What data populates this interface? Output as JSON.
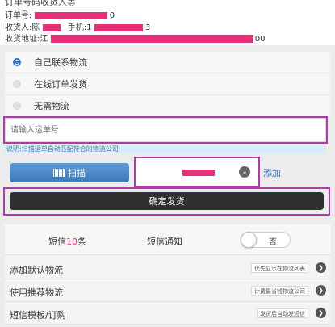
{
  "header": {
    "title_fragment": "订单号码收货人等",
    "order_label": "订单号:",
    "order_suffix": "0",
    "recipient_label": "收货人:陈",
    "phone_label": "手机:1",
    "phone_suffix": "3",
    "address_label": "收货地址:江",
    "address_suffix": "00"
  },
  "delivery_options": [
    {
      "label": "自己联系物流",
      "selected": true
    },
    {
      "label": "在线订单发货",
      "selected": false
    },
    {
      "label": "无需物流",
      "selected": false
    }
  ],
  "tracking": {
    "placeholder": "请输入运单号",
    "hint": "说明:扫描运单自动匹配符合的物流公司"
  },
  "scan_button": {
    "label": "扫描",
    "icon": "barcode-icon"
  },
  "add_link": "添加",
  "confirm_button": "确定发货",
  "sms": {
    "count_prefix": "短信",
    "count_number": "10",
    "count_suffix": "条",
    "notify_label": "短信通知",
    "toggle_text": "否"
  },
  "settings_rows": [
    {
      "label": "添加默认物流",
      "tag": "优先显示在物流列表"
    },
    {
      "label": "使用推荐物流",
      "tag": "计费最省钱物流公司"
    },
    {
      "label": "短信模板/订购",
      "tag": "发货后自动发短信"
    }
  ],
  "colors": {
    "accent": "#2f73c8",
    "redaction": "#e8307a",
    "highlight_box": "#b03aa8",
    "confirm_bg": "#303030"
  }
}
